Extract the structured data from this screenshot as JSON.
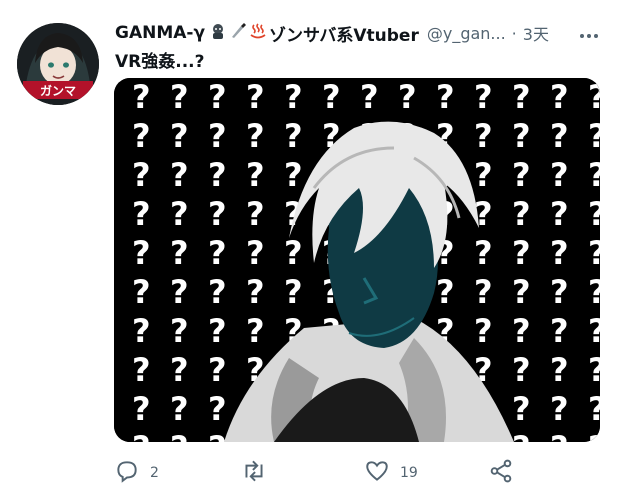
{
  "tweet": {
    "display_name": "GANMA-γ",
    "display_suffix": "ゾンサバ系Vtuber",
    "emoji_icons": [
      "zombie-emoji-icon",
      "knife-emoji-icon",
      "hot-springs-emoji-icon"
    ],
    "handle": "@y_gan...",
    "separator": "·",
    "timestamp": "3天",
    "text": "VR強姦...?",
    "avatar_text": "ガンマ"
  },
  "actions": {
    "reply_count": "2",
    "retweet_count": "",
    "like_count": "19"
  },
  "colors": {
    "text_primary": "#0f1419",
    "text_secondary": "#536471",
    "media_background": "#000000",
    "hair": "#e8e8e8",
    "skin": "#0f3a44",
    "coat": "#d9d9d9"
  }
}
